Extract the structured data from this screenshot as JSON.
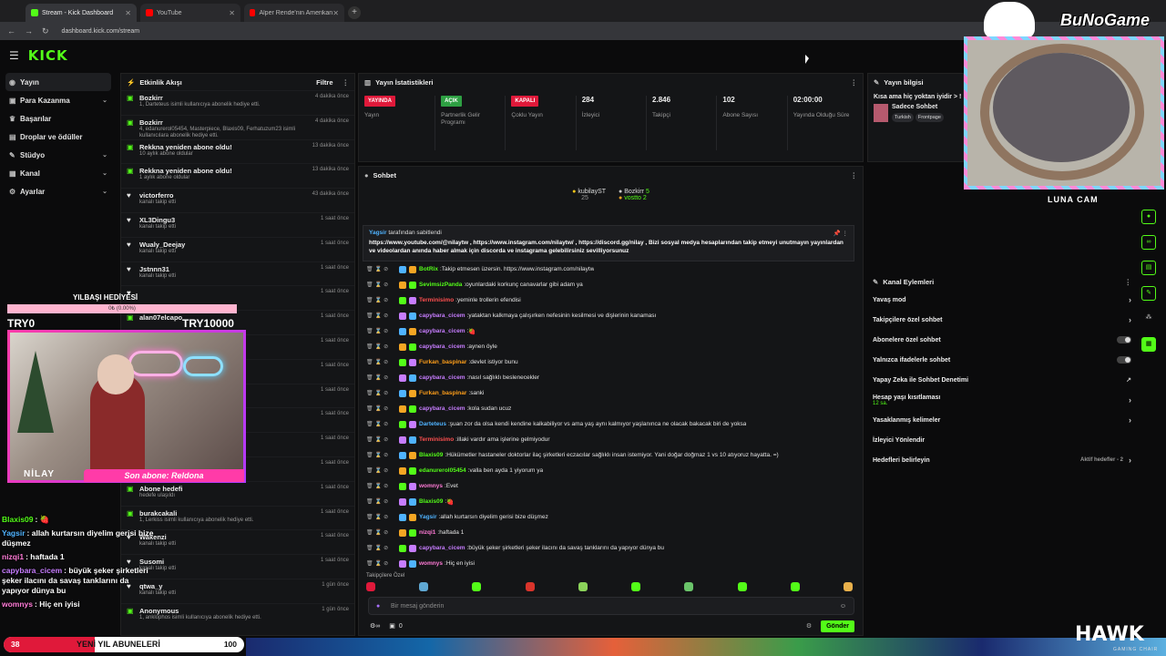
{
  "browser": {
    "tabs": [
      {
        "title": "Stream - Kick Dashboard",
        "color": "#53fc18"
      },
      {
        "title": "YouTube",
        "color": "#ff0000"
      },
      {
        "title": "Alper Rende'nin Amerikan Poli...",
        "color": "#ff0000"
      }
    ],
    "url": "dashboard.kick.com/stream"
  },
  "kick": {
    "logo": "KICK"
  },
  "sidebar": {
    "items": [
      {
        "label": "Yayın",
        "icon": "broadcast-icon",
        "chev": ""
      },
      {
        "label": "Para Kazanma",
        "icon": "money-icon",
        "chev": "⌄"
      },
      {
        "label": "Başarılar",
        "icon": "trophy-icon",
        "chev": ""
      },
      {
        "label": "Droplar ve ödüller",
        "icon": "gift-icon",
        "chev": ""
      },
      {
        "label": "Stüdyo",
        "icon": "studio-icon",
        "chev": "⌄"
      },
      {
        "label": "Kanal",
        "icon": "channel-icon",
        "chev": "⌄"
      },
      {
        "label": "Ayarlar",
        "icon": "gear-icon",
        "chev": "⌄"
      }
    ]
  },
  "activity": {
    "title": "Etkinlik Akışı",
    "filter": "Filtre",
    "events": [
      {
        "name": "Bozkirr",
        "desc": "1, Darteteus isimli kullanıcıya abonelik hediye etti.",
        "time": "4 dakika önce"
      },
      {
        "name": "Bozkirr",
        "desc": "4, edanurerol05454, Masterpiece, Blaxis09, Ferhatuzum23 isimli kullanıcılara abonelik hediye etti.",
        "time": "4 dakika önce"
      },
      {
        "name": "Rekkna yeniden abone oldu!",
        "desc": "10 aylık abone oldular",
        "time": "13 dakika önce"
      },
      {
        "name": "Rekkna yeniden abone oldu!",
        "desc": "1 aylık abone oldular",
        "time": "13 dakika önce"
      },
      {
        "name": "victorferro",
        "desc": "kanalı takip etti",
        "time": "43 dakika önce"
      },
      {
        "name": "XL3Dingu3",
        "desc": "kanalı takip etti",
        "time": "1 saat önce"
      },
      {
        "name": "Wualy_Deejay",
        "desc": "kanalı takip etti",
        "time": "1 saat önce"
      },
      {
        "name": "Jstnnn31",
        "desc": "kanalı takip etti",
        "time": "1 saat önce"
      },
      {
        "name": "",
        "desc": "",
        "time": "1 saat önce"
      },
      {
        "name": "alan07elcapo",
        "desc": "",
        "time": "1 saat önce"
      },
      {
        "name": "",
        "desc": "",
        "time": "1 saat önce"
      },
      {
        "name": "",
        "desc": "",
        "time": "1 saat önce"
      },
      {
        "name": "",
        "desc": "",
        "time": "1 saat önce"
      },
      {
        "name": "",
        "desc": "",
        "time": "1 saat önce"
      },
      {
        "name": "",
        "desc": "",
        "time": "1 saat önce"
      },
      {
        "name": "",
        "desc": "",
        "time": "1 saat önce"
      },
      {
        "name": "Abone hedefi",
        "desc": "hedefe ulaşıldı",
        "time": "1 saat önce"
      },
      {
        "name": "burakcakali",
        "desc": "1, Lerkiss isimli kullanıcıya abonelik hediye etti.",
        "time": "1 saat önce"
      },
      {
        "name": "Wakenzi",
        "desc": "kanalı takip etti",
        "time": "1 saat önce"
      },
      {
        "name": "Susomi",
        "desc": "kanalı takip etti",
        "time": "1 saat önce"
      },
      {
        "name": "qtwa_y",
        "desc": "kanalı takip etti",
        "time": "1 gün önce"
      },
      {
        "name": "Anonymous",
        "desc": "1, anklophos isimli kullanıcıya abonelik hediye etti.",
        "time": "1 gün önce"
      }
    ]
  },
  "stats": {
    "title": "Yayın İstatistikleri",
    "items": [
      {
        "badge": "YAYINDA",
        "badge_color": "#e0193a",
        "value": "",
        "label": "Yayın"
      },
      {
        "badge": "AÇIK",
        "badge_color": "#2ea043",
        "value": "",
        "label": "Partnerlik Gelir Programı"
      },
      {
        "badge": "KAPALI",
        "badge_color": "#e0193a",
        "value": "",
        "label": "Çoklu Yayın"
      },
      {
        "badge": "",
        "badge_color": "",
        "value": "284",
        "label": "İzleyici"
      },
      {
        "badge": "",
        "badge_color": "",
        "value": "2.846",
        "label": "Takipçi"
      },
      {
        "badge": "",
        "badge_color": "",
        "value": "102",
        "label": "Abone Sayısı"
      },
      {
        "badge": "",
        "badge_color": "",
        "value": "02:00:00",
        "label": "Yayında Olduğu Süre"
      }
    ]
  },
  "chat": {
    "title": "Sohbet",
    "top_chatters": [
      {
        "name": "kubilayST",
        "count": "25"
      },
      {
        "name": "Bozkirr",
        "count": "5"
      },
      {
        "name": "vostto",
        "count": "2"
      }
    ],
    "pinned": {
      "by": "Yagsir",
      "label": "tarafından sabitlendi",
      "text": "https://www.youtube.com/@nilaytw , https://www.instagram.com/nilaytw/ , https://discord.gg/nilay , Bizi sosyal medya hesaplarından takip etmeyi unutmayın yayınlardan ve videolardan anında haber almak için discorda ve instagrama gelebilirsiniz sevilliyorsunuz"
    },
    "messages": [
      {
        "user": "BotRix",
        "color": "#53fc18",
        "text": "Takip etmesen üzersin. https://www.instagram.com/nilaytw"
      },
      {
        "user": "SevimsizPanda",
        "color": "#53fc18",
        "text": "oyunlardaki korkunç canavarlar gibi adam ya"
      },
      {
        "user": "Terminisimo",
        "color": "#ff4f4f",
        "text": "yeminle trollerin efendisi"
      },
      {
        "user": "capybara_cicem",
        "color": "#c77dff",
        "text": "yataktan kalkmaya çalışırken nefesinin kesilmesi ve dişlerinin kanaması"
      },
      {
        "user": "capybara_cicem",
        "color": "#c77dff",
        "text": "🍓"
      },
      {
        "user": "capybara_cicem",
        "color": "#c77dff",
        "text": "aynen öyle"
      },
      {
        "user": "Furkan_baspinar",
        "color": "#ff9f1a",
        "text": "devlet istiyor bunu"
      },
      {
        "user": "capybara_cicem",
        "color": "#c77dff",
        "text": "nasıl sağlıklı beslenecekler"
      },
      {
        "user": "Furkan_baspinar",
        "color": "#ff9f1a",
        "text": "sanki"
      },
      {
        "user": "capybara_cicem",
        "color": "#c77dff",
        "text": "kola sudan ucuz"
      },
      {
        "user": "Darteteus",
        "color": "#4fb3ff",
        "text": "şuan zor da olsa kendi kendine kalkabiliyor vs ama yaş aynı kalmıyor yaşlanınca ne olacak bakacak biri de yoksa"
      },
      {
        "user": "Terminisimo",
        "color": "#ff4f4f",
        "text": "illaki vardır ama işlerine gelmiyodur"
      },
      {
        "user": "Blaxis09",
        "color": "#53fc18",
        "text": "Hükümetler hastaneler doktorlar ilaç şirketleri eczacılar sağlıklı insan istemiyor. Yani doğar doğmaz 1 vs 10 atıyoruz hayatta. =)"
      },
      {
        "user": "edanurerol05454",
        "color": "#53fc18",
        "text": "valla ben ayda 1 yiyorum ya"
      },
      {
        "user": "womnys",
        "color": "#ff7ad6",
        "text": "Evet"
      },
      {
        "user": "Blaxis09",
        "color": "#53fc18",
        "text": "🍓"
      },
      {
        "user": "Yagsir",
        "color": "#4fb3ff",
        "text": "allah kurtarsın diyelim gerisi bize düşmez"
      },
      {
        "user": "nizqi1",
        "color": "#ff7ad6",
        "text": "haftada 1"
      },
      {
        "user": "capybara_cicem",
        "color": "#c77dff",
        "text": "büyük şeker şirketleri şeker ilacını da savaş tanklarını da yapıyor dünya bu"
      },
      {
        "user": "womnys",
        "color": "#ff7ad6",
        "text": "Hiç en iyisi"
      }
    ],
    "favorites_label": "Takipçilere Özel",
    "input_placeholder": "Bir mesaj gönderin",
    "footer_count": "0",
    "send_label": "Gönder"
  },
  "stream_info": {
    "title": "Yayın bilgisi",
    "stream_title": "Kısa ama hiç yoktan iyidir > !",
    "category": "Sadece Sohbet",
    "tags": [
      "Turkish",
      "Frontpage"
    ]
  },
  "channel_actions": {
    "title": "Kanal Eylemleri",
    "items": [
      {
        "label": "Yavaş mod",
        "sub": "",
        "control": "chevron"
      },
      {
        "label": "Takipçilere özel sohbet",
        "sub": "",
        "control": "chevron"
      },
      {
        "label": "Abonelere özel sohbet",
        "sub": "",
        "control": "toggle"
      },
      {
        "label": "Yalnızca ifadelerle sohbet",
        "sub": "",
        "control": "toggle"
      },
      {
        "label": "Yapay Zeka ile Sohbet Denetimi",
        "sub": "",
        "control": "external"
      },
      {
        "label": "Hesap yaşı kısıtlaması",
        "sub": "12 sa.",
        "control": "chevron"
      },
      {
        "label": "Yasaklanmış kelimeler",
        "sub": "",
        "control": "chevron"
      },
      {
        "label": "İzleyici Yönlendir",
        "sub": "",
        "control": "none"
      },
      {
        "label": "Hedefleri belirleyin",
        "sub": "",
        "control": "goal"
      }
    ],
    "goal_status": "Aktif hedefler - 2"
  },
  "overlay": {
    "goal_label": "YILBAŞI HEDİYESİ",
    "goal_progress_text": "0₺ (0.00%)",
    "goal_progress": 0.0,
    "try_left": "TRY0",
    "try_right": "TRY10000",
    "streamer_name": "NİLAY",
    "last_sub": "Son abone: Reldona",
    "cam_label": "LUNA CAM",
    "brand": "BuNoGame",
    "chat": [
      {
        "user": "Blaxis09",
        "color": "#53fc18",
        "text": "🍓"
      },
      {
        "user": "Yagsir",
        "color": "#4fb3ff",
        "text": "allah kurtarsın diyelim gerisi bize düşmez"
      },
      {
        "user": "nizqi1",
        "color": "#ff7ad6",
        "text": "haftada 1"
      },
      {
        "user": "capybara_cicem",
        "color": "#c77dff",
        "text": "büyük şeker şirketleri şeker ilacını da savaş tanklarını da yapıyor dünya bu"
      },
      {
        "user": "womnys",
        "color": "#ff7ad6",
        "text": "Hiç en iyisi"
      }
    ],
    "subs_bar": {
      "current": "38",
      "label": "YENİ YIL ABUNELERİ",
      "target": "100",
      "progress": 0.38
    },
    "sponsor": "HAWK",
    "sponsor_sub": "GAMING CHAIR"
  }
}
